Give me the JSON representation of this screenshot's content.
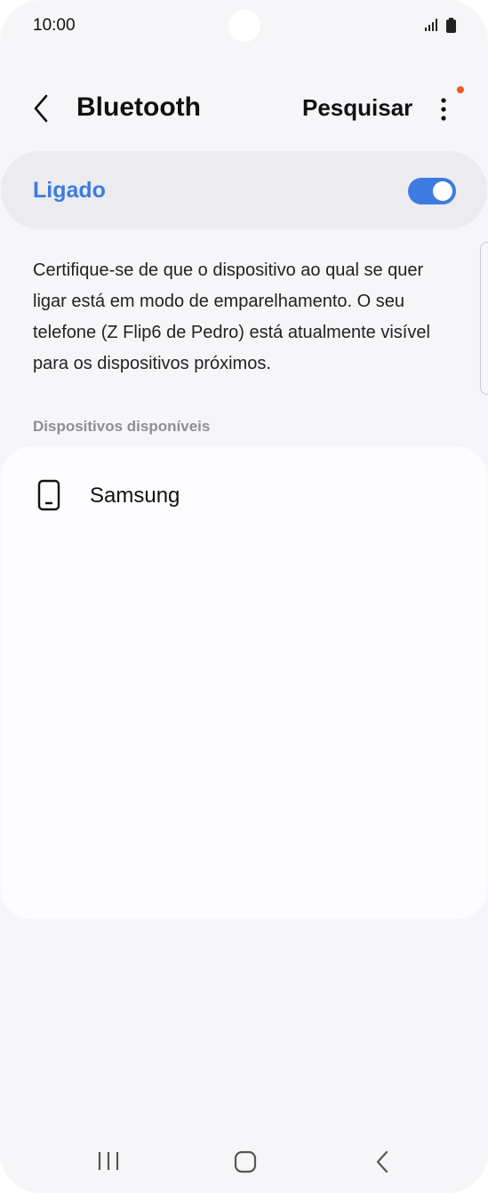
{
  "status_bar": {
    "time": "10:00",
    "icons": [
      "signal-icon",
      "battery-icon"
    ]
  },
  "header": {
    "title": "Bluetooth",
    "back_icon": "chevron-left-icon",
    "search_label": "Pesquisar",
    "more_icon": "more-vertical-icon",
    "notification_dot_color": "#f05a22"
  },
  "bluetooth_toggle": {
    "label": "Ligado",
    "state": "on",
    "accent_color": "#3e7be0"
  },
  "info_text": "Certifique-se de que o dispositivo ao qual se quer ligar está em modo de emparelhamento. O seu telefone (Z Flip6 de Pedro) está atualmente visível para os dispositivos próximos.",
  "available_devices": {
    "section_label": "Dispositivos disponíveis",
    "items": [
      {
        "name": "Samsung",
        "icon": "phone-icon"
      }
    ]
  },
  "nav_bar": {
    "icons": [
      "recent-apps-icon",
      "home-icon",
      "back-icon"
    ]
  }
}
